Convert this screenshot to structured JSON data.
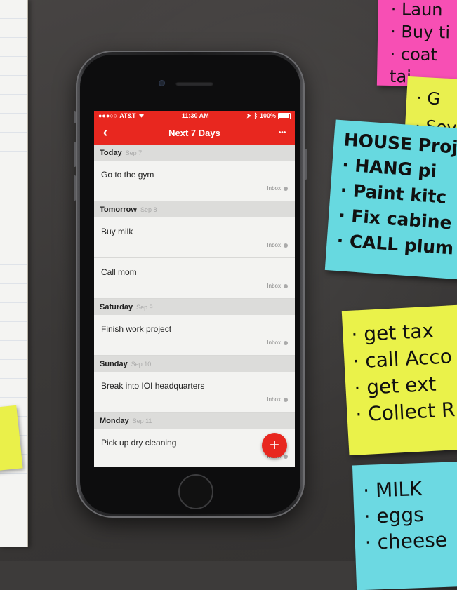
{
  "status": {
    "carrier": "AT&T",
    "time": "11:30 AM",
    "battery": "100%"
  },
  "nav": {
    "title": "Next 7 Days",
    "back_icon": "‹",
    "more_icon": "•••"
  },
  "days": [
    {
      "name": "Today",
      "date": "Sep 7",
      "tasks": [
        {
          "title": "Go to the gym",
          "project": "Inbox"
        }
      ]
    },
    {
      "name": "Tomorrow",
      "date": "Sep 8",
      "tasks": [
        {
          "title": "Buy milk",
          "project": "Inbox"
        },
        {
          "title": "Call mom",
          "project": "Inbox"
        }
      ]
    },
    {
      "name": "Saturday",
      "date": "Sep 9",
      "tasks": [
        {
          "title": "Finish work project",
          "project": "Inbox"
        }
      ]
    },
    {
      "name": "Sunday",
      "date": "Sep 10",
      "tasks": [
        {
          "title": "Break into IOI headquarters",
          "project": "Inbox"
        }
      ]
    },
    {
      "name": "Monday",
      "date": "Sep 11",
      "tasks": [
        {
          "title": "Pick up dry cleaning",
          "project": "Inbox"
        }
      ]
    }
  ],
  "fab": {
    "icon": "+"
  },
  "notes": {
    "pink": [
      "· Laun",
      "· Buy ti",
      "· coat",
      "   tai"
    ],
    "yellow1": [
      "· G",
      "· Sev"
    ],
    "teal1": [
      "HOUSE Proj",
      "· HANG pi",
      "· Paint kitc",
      "· Fix cabine",
      "· CALL plum"
    ],
    "yellow2": [
      "· get tax",
      "· call Acco",
      "· get ext",
      "· Collect R"
    ],
    "teal2": [
      "· MILK",
      "· eggs",
      "· cheese"
    ]
  },
  "colors": {
    "accent": "#e8271f",
    "screen_bg": "#ececea"
  }
}
